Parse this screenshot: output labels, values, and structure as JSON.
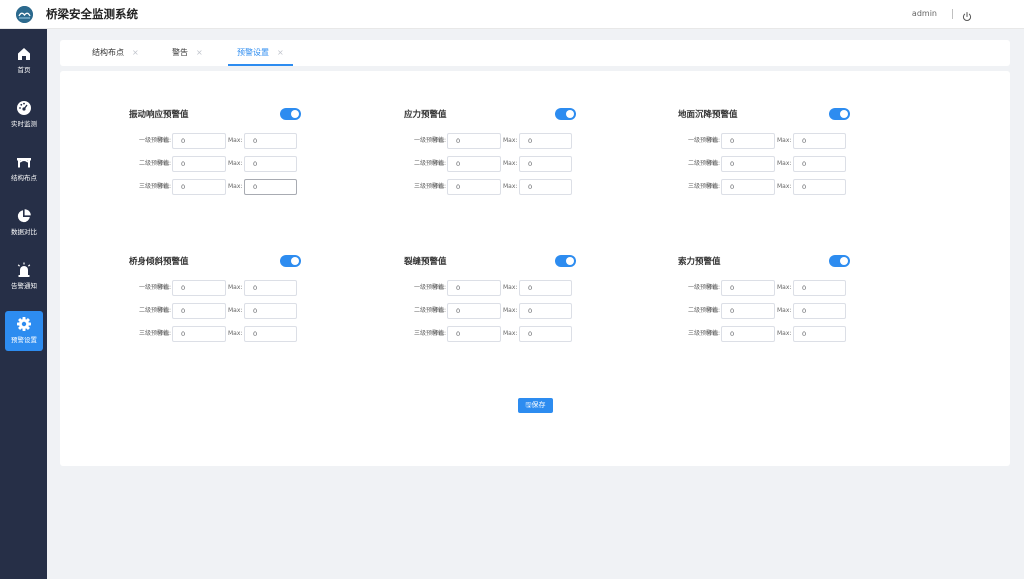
{
  "header": {
    "app_title": "桥梁安全监测系统",
    "user_name": "admin"
  },
  "sidebar": {
    "items": [
      {
        "label": "首页",
        "icon": "home-icon",
        "active": false
      },
      {
        "label": "实时监测",
        "icon": "dashboard-icon",
        "active": false
      },
      {
        "label": "结构布点",
        "icon": "bridge-icon",
        "active": false
      },
      {
        "label": "数据对比",
        "icon": "pie-chart-icon",
        "active": false
      },
      {
        "label": "告警通知",
        "icon": "alarm-icon",
        "active": false
      },
      {
        "label": "预警设置",
        "icon": "gear-icon",
        "active": true
      }
    ]
  },
  "tabs": [
    {
      "label": "结构布点",
      "active": false
    },
    {
      "label": "警告",
      "active": false
    },
    {
      "label": "预警设置",
      "active": true
    }
  ],
  "tab_close_glyph": "×",
  "row_labels": [
    "一级预警值:",
    "二级预警值:",
    "三级预警值:"
  ],
  "min_label": "Min:",
  "max_label": "Max:",
  "sections": [
    {
      "title": "振动响应预警值",
      "enabled": true,
      "rows": [
        {
          "min": "0",
          "max": "0"
        },
        {
          "min": "0",
          "max": "0"
        },
        {
          "min": "0",
          "max": "0"
        }
      ]
    },
    {
      "title": "应力预警值",
      "enabled": true,
      "rows": [
        {
          "min": "0",
          "max": "0"
        },
        {
          "min": "0",
          "max": "0"
        },
        {
          "min": "0",
          "max": "0"
        }
      ]
    },
    {
      "title": "地面沉降预警值",
      "enabled": true,
      "rows": [
        {
          "min": "0",
          "max": "0"
        },
        {
          "min": "0",
          "max": "0"
        },
        {
          "min": "0",
          "max": "0"
        }
      ]
    },
    {
      "title": "桥身倾斜预警值",
      "enabled": true,
      "rows": [
        {
          "min": "0",
          "max": "0"
        },
        {
          "min": "0",
          "max": "0"
        },
        {
          "min": "0",
          "max": "0"
        }
      ]
    },
    {
      "title": "裂缝预警值",
      "enabled": true,
      "rows": [
        {
          "min": "0",
          "max": "0"
        },
        {
          "min": "0",
          "max": "0"
        },
        {
          "min": "0",
          "max": "0"
        }
      ]
    },
    {
      "title": "索力预警值",
      "enabled": true,
      "rows": [
        {
          "min": "0",
          "max": "0"
        },
        {
          "min": "0",
          "max": "0"
        },
        {
          "min": "0",
          "max": "0"
        }
      ]
    }
  ],
  "save_button": {
    "label": "🖫保存"
  },
  "colors": {
    "primary": "#2d8cf0",
    "sidebar": "#262f47"
  }
}
